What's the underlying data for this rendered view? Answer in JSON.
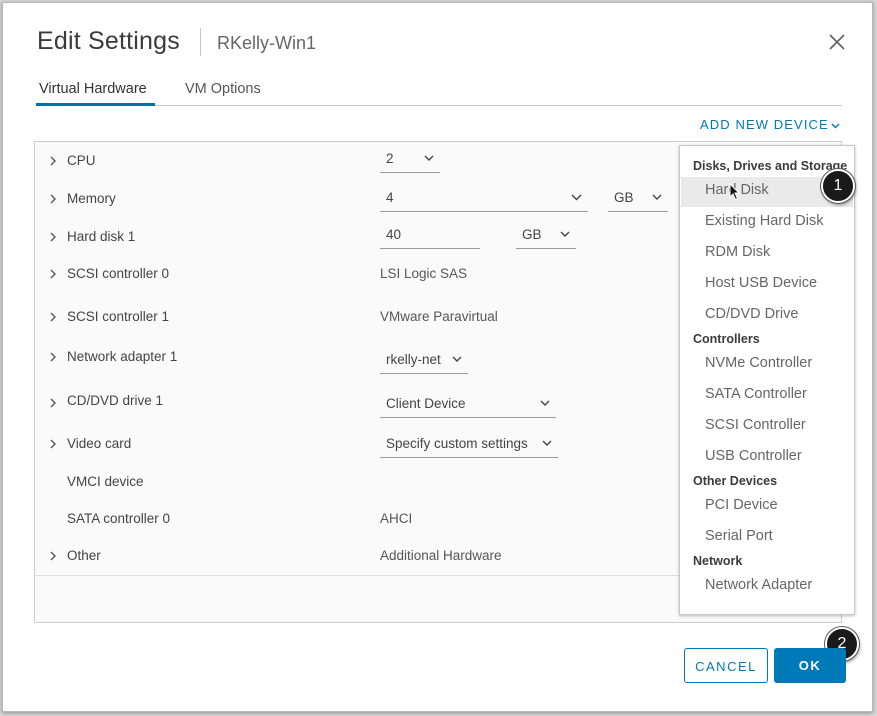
{
  "dialog": {
    "title": "Edit Settings",
    "vm_name": "RKelly-Win1",
    "close_icon": "close-icon"
  },
  "tabs": [
    {
      "label": "Virtual Hardware",
      "active": true
    },
    {
      "label": "VM Options",
      "active": false
    }
  ],
  "toolbar": {
    "add_new_device_label": "ADD NEW DEVICE"
  },
  "hardware": {
    "cpu": {
      "label": "CPU",
      "value": "2"
    },
    "memory": {
      "label": "Memory",
      "value": "4",
      "unit": "GB"
    },
    "hard_disk": {
      "label": "Hard disk 1",
      "value": "40",
      "unit": "GB"
    },
    "scsi0": {
      "label": "SCSI controller 0",
      "value": "LSI Logic SAS"
    },
    "scsi1": {
      "label": "SCSI controller 1",
      "value": "VMware Paravirtual"
    },
    "network": {
      "label": "Network adapter 1",
      "value": "rkelly-net"
    },
    "cddvd": {
      "label": "CD/DVD drive 1",
      "value": "Client Device"
    },
    "video": {
      "label": "Video card",
      "value": "Specify custom settings"
    },
    "vmci": {
      "label": "VMCI device"
    },
    "sata": {
      "label": "SATA controller 0",
      "value": "AHCI"
    },
    "other": {
      "label": "Other",
      "value": "Additional Hardware"
    }
  },
  "add_device_menu": {
    "disks_header": "Disks, Drives and Storage",
    "hard_disk": "Hard Disk",
    "existing_hard_disk": "Existing Hard Disk",
    "rdm_disk": "RDM Disk",
    "host_usb": "Host USB Device",
    "cd_dvd": "CD/DVD Drive",
    "controllers_header": "Controllers",
    "nvme": "NVMe Controller",
    "sata": "SATA Controller",
    "scsi": "SCSI Controller",
    "usb": "USB Controller",
    "other_header": "Other Devices",
    "pci": "PCI Device",
    "serial": "Serial Port",
    "network_header": "Network",
    "network_adapter": "Network Adapter"
  },
  "callouts": {
    "step1": "1",
    "step2": "2"
  },
  "footer": {
    "cancel_label": "CANCEL",
    "ok_label": "OK"
  },
  "colors": {
    "accent": "#0079b8",
    "tab_underline": "#0072a3"
  }
}
